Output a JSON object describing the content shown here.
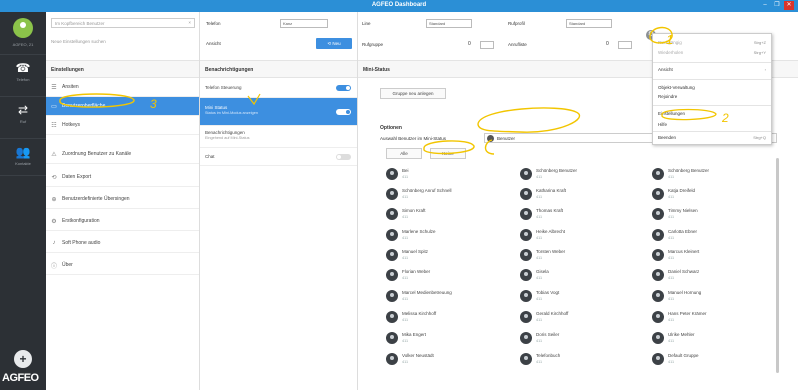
{
  "window": {
    "title": "AGFEO Dashboard",
    "controls": [
      "–",
      "❐",
      "✕"
    ]
  },
  "leftbar": {
    "user_label": "AGFEO, 21",
    "nav": [
      {
        "icon": "phone-icon",
        "glyph": "☎",
        "label": "Telefon"
      },
      {
        "icon": "transfer-icon",
        "glyph": "⇄",
        "label": "Ruf"
      },
      {
        "icon": "contacts-icon",
        "glyph": "👥",
        "label": "Kontakte"
      }
    ],
    "plus": "+",
    "logo": "AGFEO"
  },
  "col1": {
    "search_placeholder": "Im Kopfbereich Benutzer",
    "search_clear": "×",
    "search2": "Neue Einstellungen suchen",
    "heading": "Einstellungen",
    "items": [
      {
        "glyph": "☰",
        "label": "Ansiten"
      },
      {
        "glyph": "▭",
        "label": "Benutzeroberfläche"
      },
      {
        "glyph": "☷",
        "label": "Hotkeys"
      },
      {
        "glyph": "⚠",
        "label": "Zuordnung Benutzer zu Kanäle"
      },
      {
        "glyph": "⟲",
        "label": "Daten Export"
      },
      {
        "glyph": "⊕",
        "label": "Benutzerdefinierte Übersingen"
      },
      {
        "glyph": "⚙",
        "label": "Erstkonfiguration"
      },
      {
        "glyph": "♪",
        "label": "Soft Phone audio"
      },
      {
        "glyph": "ⓘ",
        "label": "Über"
      }
    ]
  },
  "col2": {
    "label_telefon": "Telefon",
    "telefon_value": "Kanz",
    "label_ansicht": "Ansicht",
    "button": "⟲ Neu",
    "heading": "Benachrichtigungen",
    "options": [
      {
        "label": "Telefon Steuerung",
        "sub": ""
      },
      {
        "label": "Mini Status",
        "sub": "Status im Mini-Modus anzeigen"
      },
      {
        "label": "Benachrichtigungen",
        "sub": "Eingehend auf Mini-Status"
      },
      {
        "label": "Chat",
        "sub": ""
      }
    ]
  },
  "col3": {
    "label_line": "Line",
    "line_value": "Standard",
    "label_rufprofil": "Rufprofil",
    "rufprofil_value": "Standard",
    "label_rufgruppe": "Rufgruppe",
    "rufgruppe_value": "0",
    "label_anrufliste": "Anrufliste",
    "anrufliste_value": "0",
    "heading": "Mini-Status",
    "btn_gruppe": "Gruppe neu anlegen",
    "options_label": "Optionen",
    "auswahl_label": "Auswahl Benutzer im Mini-Status",
    "dropdown_value": "Benutzer",
    "dropdown_chev": "⌄",
    "btn_alle": "Alle",
    "btn_keine": "Keine"
  },
  "users": [
    {
      "name": "Bei",
      "ext": "411"
    },
    {
      "name": "Schönberg Benutzer",
      "ext": "411"
    },
    {
      "name": "Schönberg Benutzer",
      "ext": "411"
    },
    {
      "name": "Schönberg Anruf Schnell",
      "ext": "411"
    },
    {
      "name": "Katharina Kraft",
      "ext": "411"
    },
    {
      "name": "Katja Dreifeld",
      "ext": "411"
    },
    {
      "name": "Simon Kraft",
      "ext": "411"
    },
    {
      "name": "Thomas Kraft",
      "ext": "411"
    },
    {
      "name": "Timmy Nielsen",
      "ext": "411"
    },
    {
      "name": "Marlene Schulze",
      "ext": "411"
    },
    {
      "name": "Heike Albrecht",
      "ext": "411"
    },
    {
      "name": "Carlotta Ebner",
      "ext": "411"
    },
    {
      "name": "Manuel Spitz",
      "ext": "411"
    },
    {
      "name": "Torsten Weber",
      "ext": "411"
    },
    {
      "name": "Marcus Kleinert",
      "ext": "411"
    },
    {
      "name": "Florian Weber",
      "ext": "411"
    },
    {
      "name": "Gisela",
      "ext": "411"
    },
    {
      "name": "Daniel Schwarz",
      "ext": "411"
    },
    {
      "name": "Marcel Medienbetreuung",
      "ext": "411"
    },
    {
      "name": "Tobias Vogt",
      "ext": "411"
    },
    {
      "name": "Manuel Hornung",
      "ext": "411"
    },
    {
      "name": "Melissa Kirchhoff",
      "ext": "411"
    },
    {
      "name": "Gerald Kirchhoff",
      "ext": "411"
    },
    {
      "name": "Hans Peter Krämer",
      "ext": "411"
    },
    {
      "name": "Mika Engert",
      "ext": "411"
    },
    {
      "name": "Doris Seiler",
      "ext": "411"
    },
    {
      "name": "Ulrike Mehler",
      "ext": "411"
    },
    {
      "name": "Volker Neustädt",
      "ext": "411"
    },
    {
      "name": "Telefonbuch",
      "ext": "411"
    },
    {
      "name": "Default Gruppe",
      "ext": "411"
    }
  ],
  "menu": {
    "items": [
      {
        "label": "Rückgängig",
        "shortcut": "Strg+Z",
        "disabled": true
      },
      {
        "label": "Wiederholen",
        "shortcut": "Strg+Y",
        "disabled": true
      },
      {
        "label": "Ansicht",
        "shortcut": "›",
        "disabled": false
      },
      {
        "label": "Objekt-Verwaltung",
        "shortcut": "",
        "disabled": false
      },
      {
        "label": "Rejoindre",
        "shortcut": "",
        "disabled": false
      },
      {
        "label": "Einstellungen",
        "shortcut": "",
        "disabled": false
      },
      {
        "label": "Hilfe",
        "shortcut": "",
        "disabled": false
      },
      {
        "label": "Beenden",
        "shortcut": "Strg+Q",
        "disabled": false
      }
    ]
  },
  "annotations": {
    "n1": "1",
    "n2": "2",
    "n3": "3"
  },
  "colors": {
    "accent": "#3d8fe0",
    "titlebar": "#2b8fd6",
    "sidebar": "#2c3035",
    "annotation": "#f2c500"
  }
}
